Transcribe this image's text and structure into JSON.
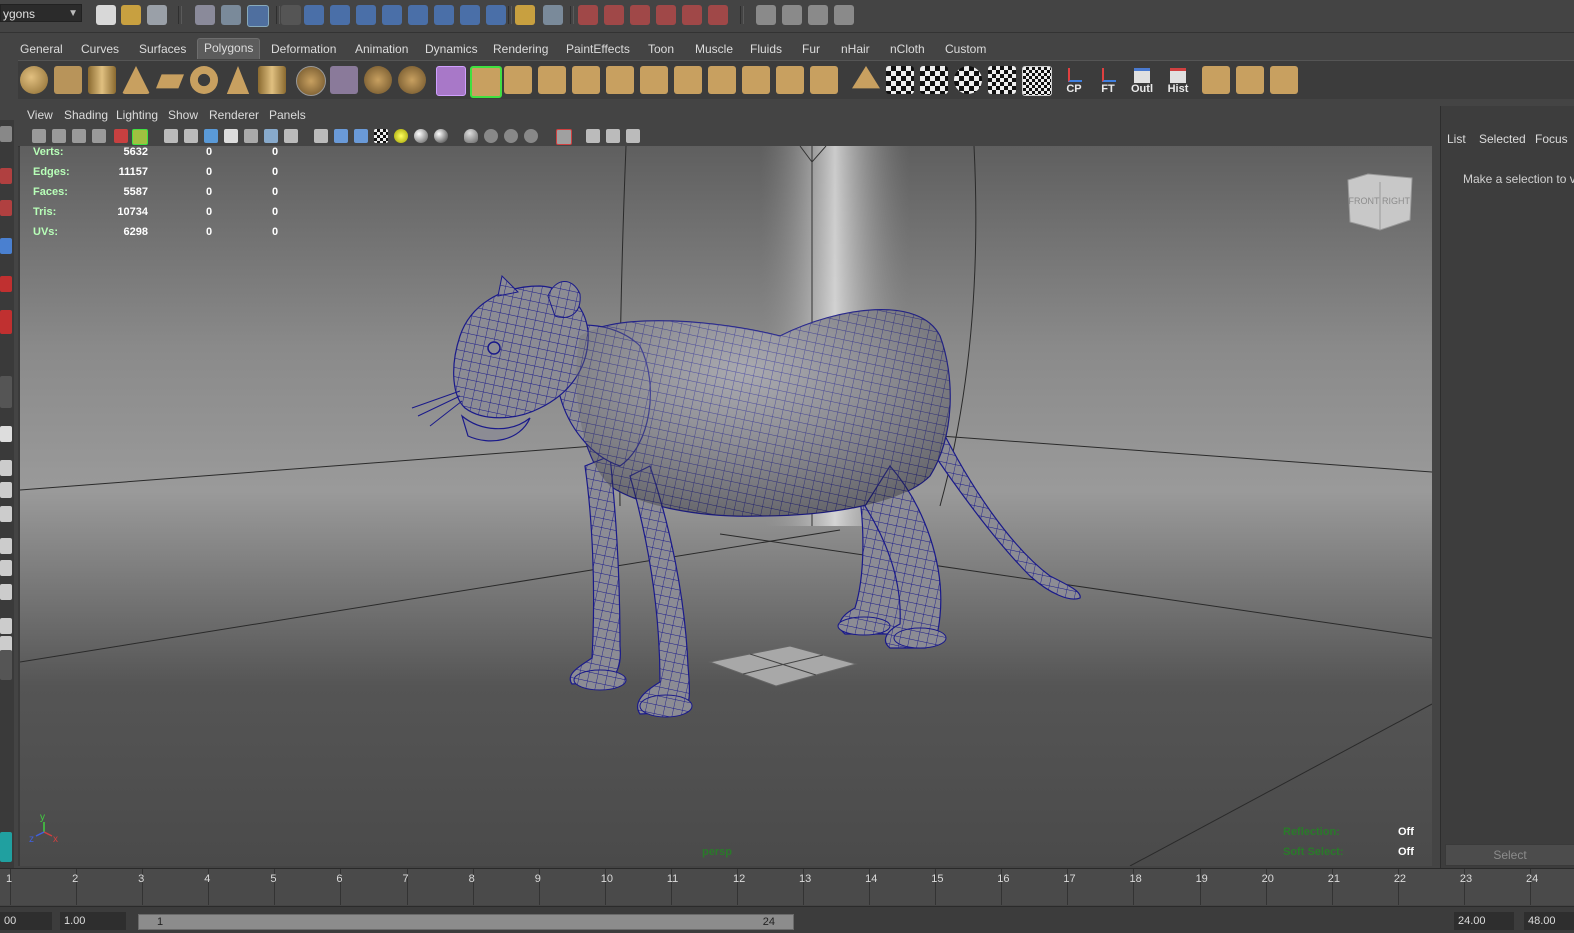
{
  "status_line": {
    "mode": "ygons"
  },
  "shelf_tabs": [
    "General",
    "Curves",
    "Surfaces",
    "Polygons",
    "Deformation",
    "Animation",
    "Dynamics",
    "Rendering",
    "PaintEffects",
    "Toon",
    "Muscle",
    "Fluids",
    "Fur",
    "nHair",
    "nCloth",
    "Custom"
  ],
  "shelf": {
    "cp_label": "CP",
    "ft_label": "FT",
    "outl_label": "Outl",
    "hist_label": "Hist"
  },
  "panel_menu": [
    "View",
    "Shading",
    "Lighting",
    "Show",
    "Renderer",
    "Panels"
  ],
  "hud": {
    "rows": [
      {
        "label": "Verts:",
        "value": "5632",
        "a": "0",
        "b": "0"
      },
      {
        "label": "Edges:",
        "value": "11157",
        "a": "0",
        "b": "0"
      },
      {
        "label": "Faces:",
        "value": "5587",
        "a": "0",
        "b": "0"
      },
      {
        "label": "Tris:",
        "value": "10734",
        "a": "0",
        "b": "0"
      },
      {
        "label": "UVs:",
        "value": "6298",
        "a": "0",
        "b": "0"
      }
    ],
    "camera": "persp",
    "reflection_label": "Reflection:",
    "reflection_value": "Off",
    "soft_select_label": "Soft Select:",
    "soft_select_value": "Off",
    "viewcube_front": "FRONT",
    "viewcube_right": "RIGHT",
    "axis_x": "x",
    "axis_y": "y",
    "axis_z": "z"
  },
  "right_panel": {
    "tabs": [
      "List",
      "Selected",
      "Focus"
    ],
    "message": "Make a selection to vi",
    "select_button": "Select"
  },
  "timeline": {
    "ticks": [
      "1",
      "2",
      "3",
      "4",
      "5",
      "6",
      "7",
      "8",
      "9",
      "10",
      "11",
      "12",
      "13",
      "14",
      "15",
      "16",
      "17",
      "18",
      "19",
      "20",
      "21",
      "22",
      "23",
      "24"
    ]
  },
  "range": {
    "start": "00",
    "playback_start": "1.00",
    "slider_start": "1",
    "slider_end": "24",
    "playback_end": "24.00",
    "end": "48.00"
  },
  "colors": {
    "mesh_wire": "#1a1a8a",
    "hud_label": "#b8ffb8",
    "shelf_active": "#5c5c5c"
  }
}
